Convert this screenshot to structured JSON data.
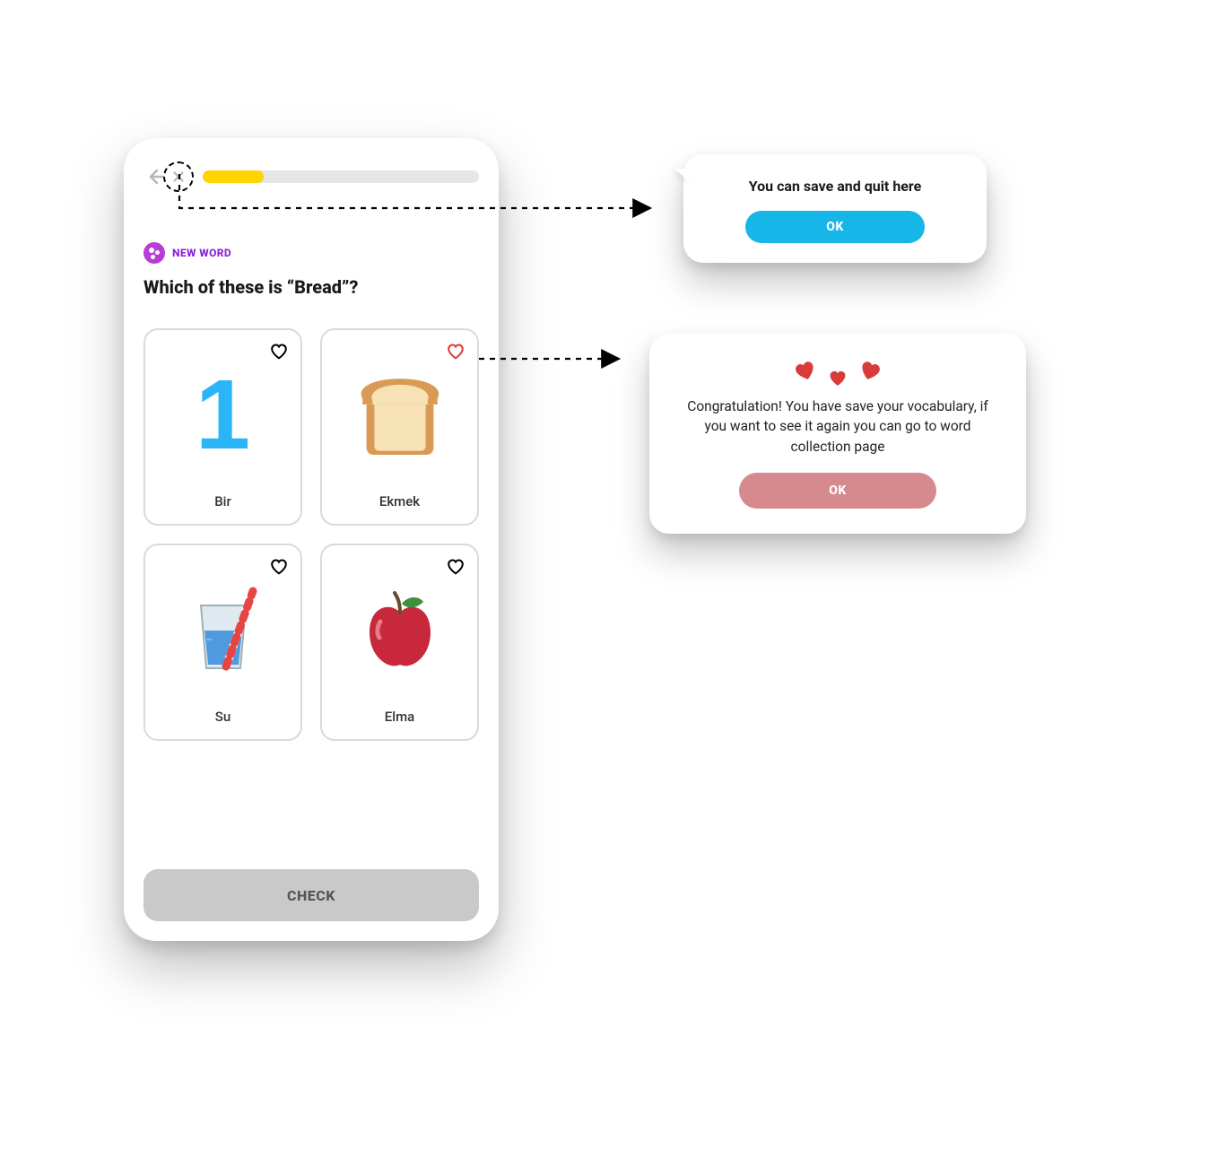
{
  "lesson": {
    "tag": "NEW WORD",
    "question": "Which of these is “Bread”?",
    "progress_percent": 22,
    "check_label": "CHECK",
    "cards": [
      {
        "label": "Bir",
        "icon": "one",
        "favorited": false
      },
      {
        "label": "Ekmek",
        "icon": "bread",
        "favorited": true
      },
      {
        "label": "Su",
        "icon": "glass",
        "favorited": false
      },
      {
        "label": "Elma",
        "icon": "apple",
        "favorited": false
      }
    ]
  },
  "popups": {
    "quit": {
      "text": "You can save and quit here",
      "ok": "OK"
    },
    "saved": {
      "text": "Congratulation! You have save your vocabulary, if you want to see it again you can go to word collection page",
      "ok": "OK"
    }
  },
  "colors": {
    "progress_fill": "#ffd400",
    "accent_purple": "#b83dd6",
    "accent_blue": "#16b7e8",
    "accent_rose": "#d68a8d",
    "heart_red": "#d93a3a"
  }
}
